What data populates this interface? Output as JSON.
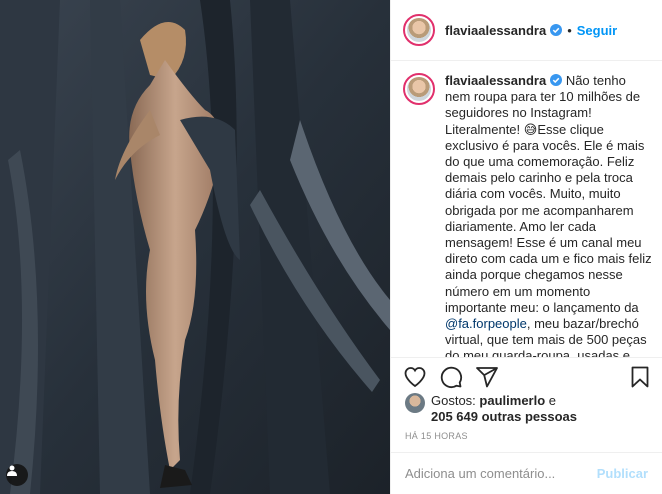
{
  "post": {
    "username": "flaviaalessandra",
    "follow_label": "Seguir",
    "separator": "•"
  },
  "caption": {
    "username": "flaviaalessandra",
    "text_part1": "Não tenho nem roupa para ter 10 milhões de seguidores no Instagram! Literalmente! 😅Esse clique exclusivo é para vocês. Ele é mais do que uma comemoração. Feliz demais pelo carinho e pela troca diária com vocês. Muito, muito obrigada por me acompanharem diariamente. Amo ler cada mensagem! Esse é um canal meu direto com cada um e fico mais feliz ainda porque chegamos nesse número em um momento importante meu: o lançamento da ",
    "mention": "@fa.forpeople",
    "text_part2": ", meu bazar/brechó virtual, que tem mais de 500 peças do meu guarda-roupa, usadas e novas, com renda revertida para ONGS e suas ações sociais. Esse é só o início do projeto"
  },
  "likes": {
    "prefix": "Gostos: ",
    "first_user": "paulimerlo",
    "connector": " e ",
    "count_text": "205 649 outras pessoas"
  },
  "timestamp": "HÁ 15 HORAS",
  "comment_box": {
    "placeholder": "Adiciona um comentário...",
    "post_label": "Publicar"
  },
  "colors": {
    "accent": "#0095f6",
    "mention": "#00376b",
    "post_disabled": "#b2dffc"
  }
}
